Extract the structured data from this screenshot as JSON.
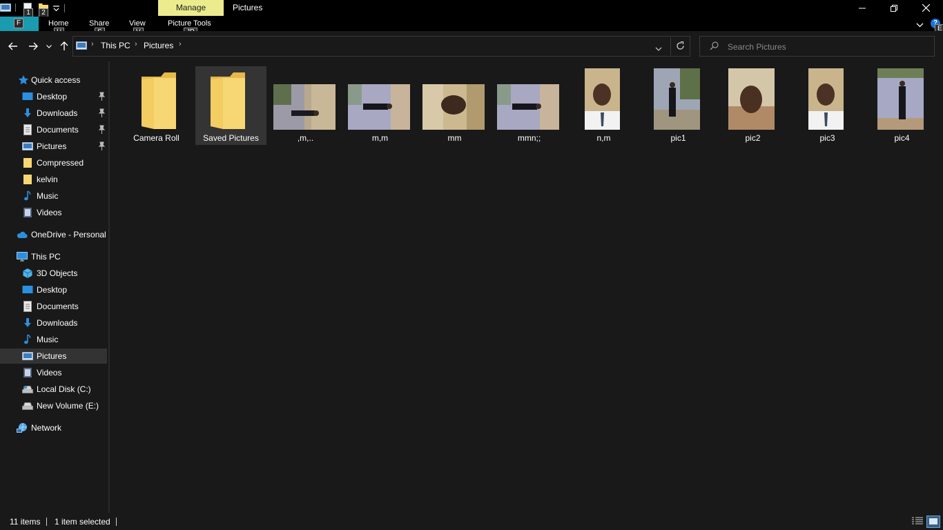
{
  "titlebar": {
    "title": "Pictures",
    "context_tab": "Manage",
    "keytips": {
      "undo": "1",
      "new_folder": "2"
    }
  },
  "ribbon": {
    "file_keytip": "F",
    "tabs": [
      {
        "label": "Home",
        "keytip": "H"
      },
      {
        "label": "Share",
        "keytip": "S"
      },
      {
        "label": "View",
        "keytip": "V"
      },
      {
        "label": "Picture Tools",
        "keytip": "JP"
      }
    ],
    "help_keytip": "E"
  },
  "address": {
    "breadcrumb": [
      "This PC",
      "Pictures"
    ]
  },
  "search": {
    "placeholder": "Search Pictures"
  },
  "sidebar": {
    "quick_access": {
      "label": "Quick access",
      "items": [
        {
          "label": "Desktop",
          "icon": "desktop-icon",
          "pinned": true
        },
        {
          "label": "Downloads",
          "icon": "download-icon",
          "pinned": true
        },
        {
          "label": "Documents",
          "icon": "document-icon",
          "pinned": true
        },
        {
          "label": "Pictures",
          "icon": "pictures-icon",
          "pinned": true
        },
        {
          "label": "Compressed",
          "icon": "folder-icon",
          "pinned": false
        },
        {
          "label": "kelvin",
          "icon": "folder-icon",
          "pinned": false
        },
        {
          "label": "Music",
          "icon": "music-icon",
          "pinned": false
        },
        {
          "label": "Videos",
          "icon": "video-icon",
          "pinned": false
        }
      ]
    },
    "onedrive": {
      "label": "OneDrive - Personal"
    },
    "this_pc": {
      "label": "This PC",
      "items": [
        {
          "label": "3D Objects",
          "icon": "3d-objects-icon"
        },
        {
          "label": "Desktop",
          "icon": "desktop-icon"
        },
        {
          "label": "Documents",
          "icon": "document-icon"
        },
        {
          "label": "Downloads",
          "icon": "download-icon"
        },
        {
          "label": "Music",
          "icon": "music-icon"
        },
        {
          "label": "Pictures",
          "icon": "pictures-icon",
          "selected": true
        },
        {
          "label": "Videos",
          "icon": "video-icon"
        },
        {
          "label": "Local Disk (C:)",
          "icon": "drive-icon"
        },
        {
          "label": "New Volume (E:)",
          "icon": "drive-icon"
        }
      ]
    },
    "network": {
      "label": "Network"
    }
  },
  "files": [
    {
      "name": "Camera Roll",
      "type": "folder"
    },
    {
      "name": "Saved Pictures",
      "type": "folder",
      "selected": true
    },
    {
      "name": ",m,..",
      "type": "image"
    },
    {
      "name": "m,m",
      "type": "image"
    },
    {
      "name": "mm",
      "type": "image"
    },
    {
      "name": "mmn;;",
      "type": "image"
    },
    {
      "name": "n,m",
      "type": "image"
    },
    {
      "name": "pic1",
      "type": "image"
    },
    {
      "name": "pic2",
      "type": "image"
    },
    {
      "name": "pic3",
      "type": "image"
    },
    {
      "name": "pic4",
      "type": "image"
    }
  ],
  "status": {
    "item_count": "11 items",
    "selection": "1 item selected"
  },
  "colors": {
    "background": "#191919",
    "accent_file_tab": "#1a9bb0",
    "manage_tab": "#ecec8f",
    "selection": "#343434",
    "folder": "#f7d774"
  }
}
